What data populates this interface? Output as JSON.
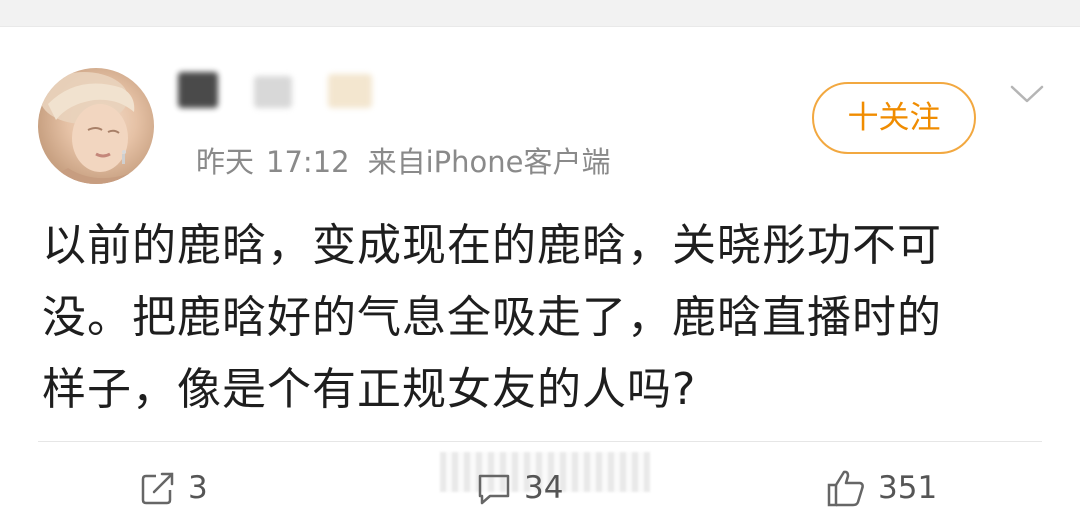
{
  "post": {
    "meta": {
      "date": "昨天",
      "time": "17:12",
      "source": "来自iPhone客户端"
    },
    "follow_label": "十关注",
    "text_lines": [
      "以前的鹿晗，变成现在的鹿晗，关晓彤功不可",
      "没。把鹿晗好的气息全吸走了，鹿晗直播时的",
      "样子，像是个有正规女友的人吗?"
    ]
  },
  "actions": {
    "repost_count": "3",
    "comment_count": "34",
    "like_count": "351"
  },
  "icons": {
    "menu": "chevron-down-icon",
    "repost": "repost-icon",
    "comment": "comment-icon",
    "like": "thumbs-up-icon"
  },
  "colors": {
    "accent": "#f08c00",
    "follow_border": "#f2a840",
    "meta_text": "#8a8a8a",
    "body_text": "#1e1e1e"
  }
}
